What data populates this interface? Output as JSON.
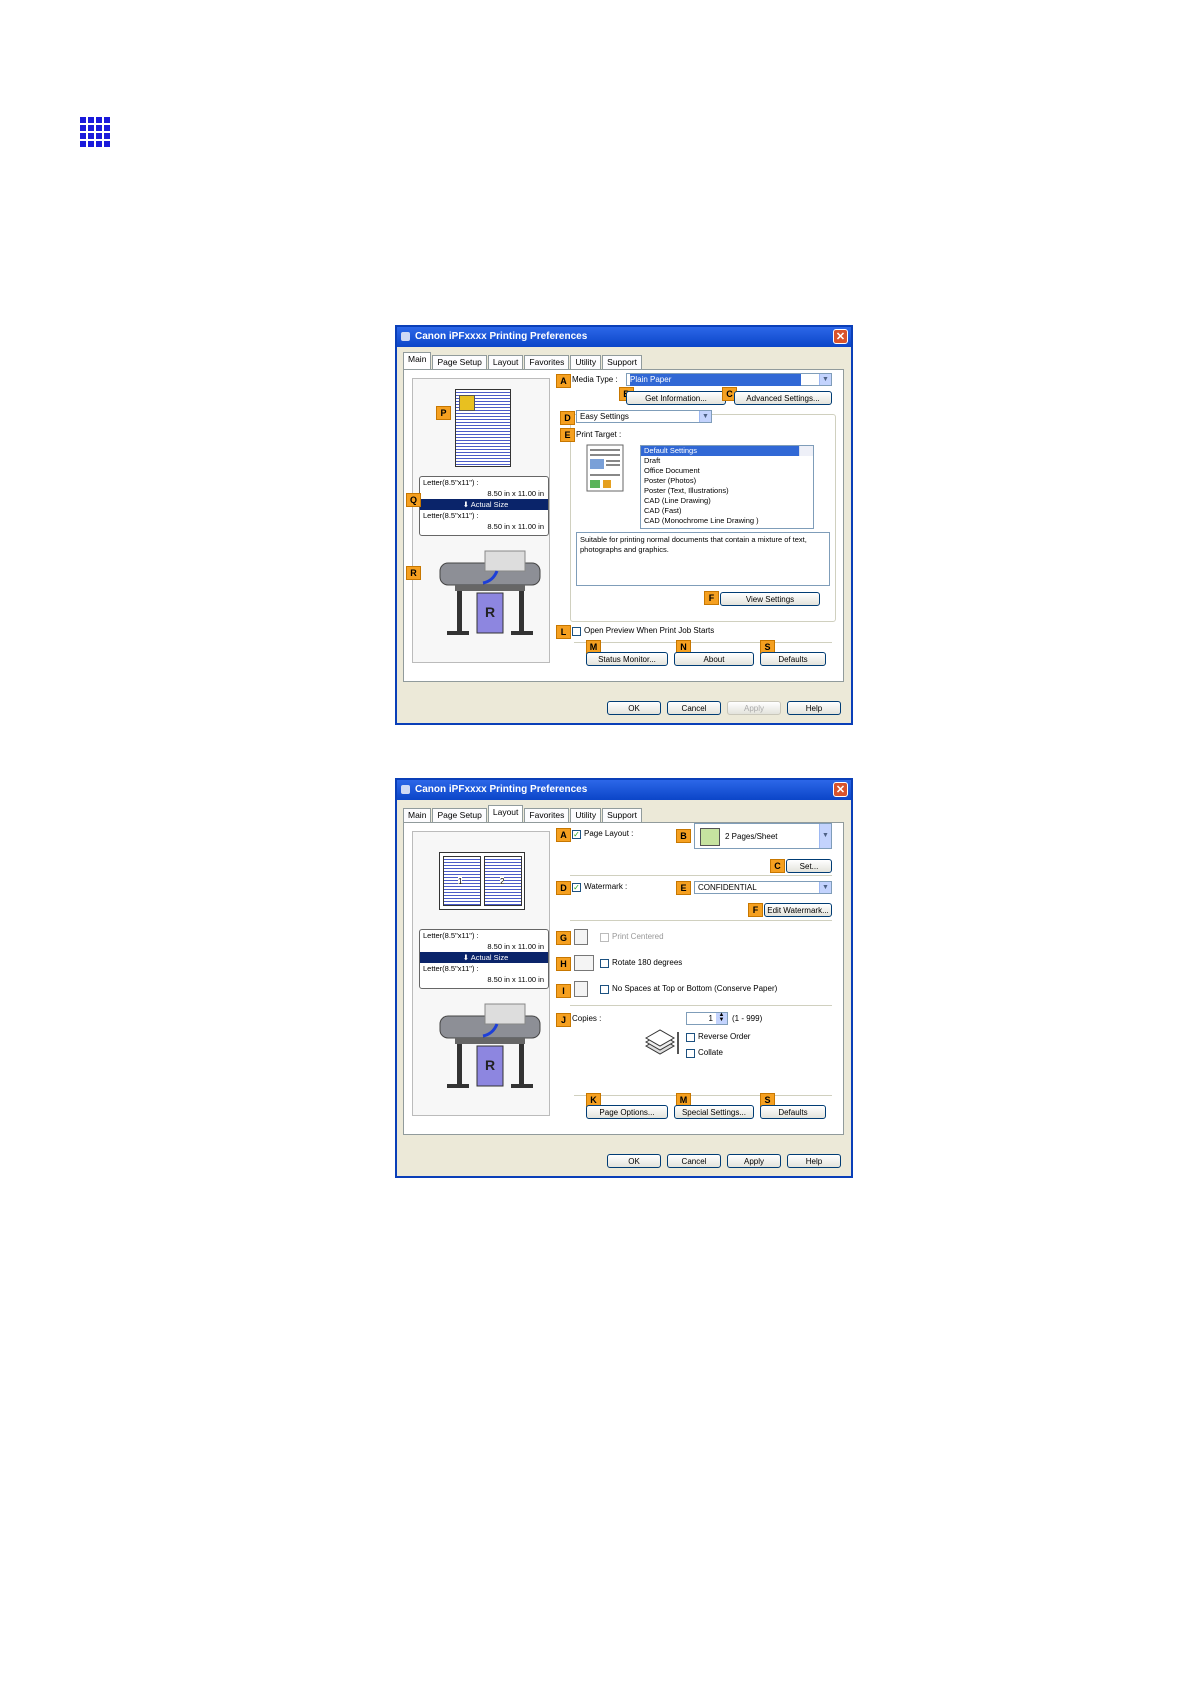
{
  "dialog1": {
    "title": "Canon iPFxxxx Printing Preferences",
    "tabs": [
      "Main",
      "Page Setup",
      "Layout",
      "Favorites",
      "Utility",
      "Support"
    ],
    "active_tab": "Main",
    "letters": {
      "A": "A",
      "B": "B",
      "C": "C",
      "D": "D",
      "E": "E",
      "F": "F",
      "L": "L",
      "M": "M",
      "N": "N",
      "S": "S",
      "P": "P",
      "Q": "Q",
      "R": "R"
    },
    "media_type_label": "Media Type :",
    "media_type_value": "Plain Paper",
    "get_information": "Get Information...",
    "advanced_settings": "Advanced Settings...",
    "mode_value": "Easy Settings",
    "print_target_label": "Print Target :",
    "print_targets": [
      "Default Settings",
      "Draft",
      "Office Document",
      "Poster (Photos)",
      "Poster (Text, Illustrations)",
      "CAD (Line Drawing)",
      "CAD (Fast)",
      "CAD (Monochrome Line Drawing )"
    ],
    "description": "Suitable for printing normal documents that contain a mixture of text, photographs and graphics.",
    "view_settings": "View Settings",
    "open_preview": "Open Preview When Print Job Starts",
    "status_monitor": "Status Monitor...",
    "about": "About",
    "defaults": "Defaults",
    "size_lines": [
      "Letter(8.5\"x11\") :",
      "8.50 in x 11.00 in",
      "Actual Size",
      "Letter(8.5\"x11\") :",
      "8.50 in x 11.00 in"
    ],
    "ok": "OK",
    "cancel": "Cancel",
    "apply": "Apply",
    "help": "Help"
  },
  "dialog2": {
    "title": "Canon iPFxxxx Printing Preferences",
    "tabs": [
      "Main",
      "Page Setup",
      "Layout",
      "Favorites",
      "Utility",
      "Support"
    ],
    "active_tab": "Layout",
    "letters": {
      "A": "A",
      "B": "B",
      "C": "C",
      "D": "D",
      "E": "E",
      "F": "F",
      "G": "G",
      "H": "H",
      "I": "I",
      "J": "J",
      "K": "K",
      "M": "M",
      "S": "S"
    },
    "page_layout": "Page Layout :",
    "pages_per_sheet": "2 Pages/Sheet",
    "set": "Set...",
    "watermark": "Watermark :",
    "watermark_value": "CONFIDENTIAL",
    "edit_watermark": "Edit Watermark...",
    "print_centered": "Print Centered",
    "rotate": "Rotate 180 degrees",
    "no_spaces": "No Spaces at Top or Bottom (Conserve Paper)",
    "copies": "Copies :",
    "copies_value": "1",
    "copies_range": "(1 - 999)",
    "reverse_order": "Reverse Order",
    "collate": "Collate",
    "page_options": "Page Options...",
    "special_settings": "Special Settings...",
    "defaults": "Defaults",
    "size_lines": [
      "Letter(8.5\"x11\") :",
      "8.50 in x 11.00 in",
      "Actual Size",
      "Letter(8.5\"x11\") :",
      "8.50 in x 11.00 in"
    ],
    "thumb_numbers": [
      "1",
      "2"
    ],
    "ok": "OK",
    "cancel": "Cancel",
    "apply": "Apply",
    "help": "Help"
  },
  "colors": {
    "accent": "#f5a020",
    "title_blue": "#0b45c8",
    "selection": "#3168d5",
    "icon_blue": "#1a1adb"
  },
  "icons": [
    "grid-icon",
    "printer-icon",
    "close-icon"
  ]
}
